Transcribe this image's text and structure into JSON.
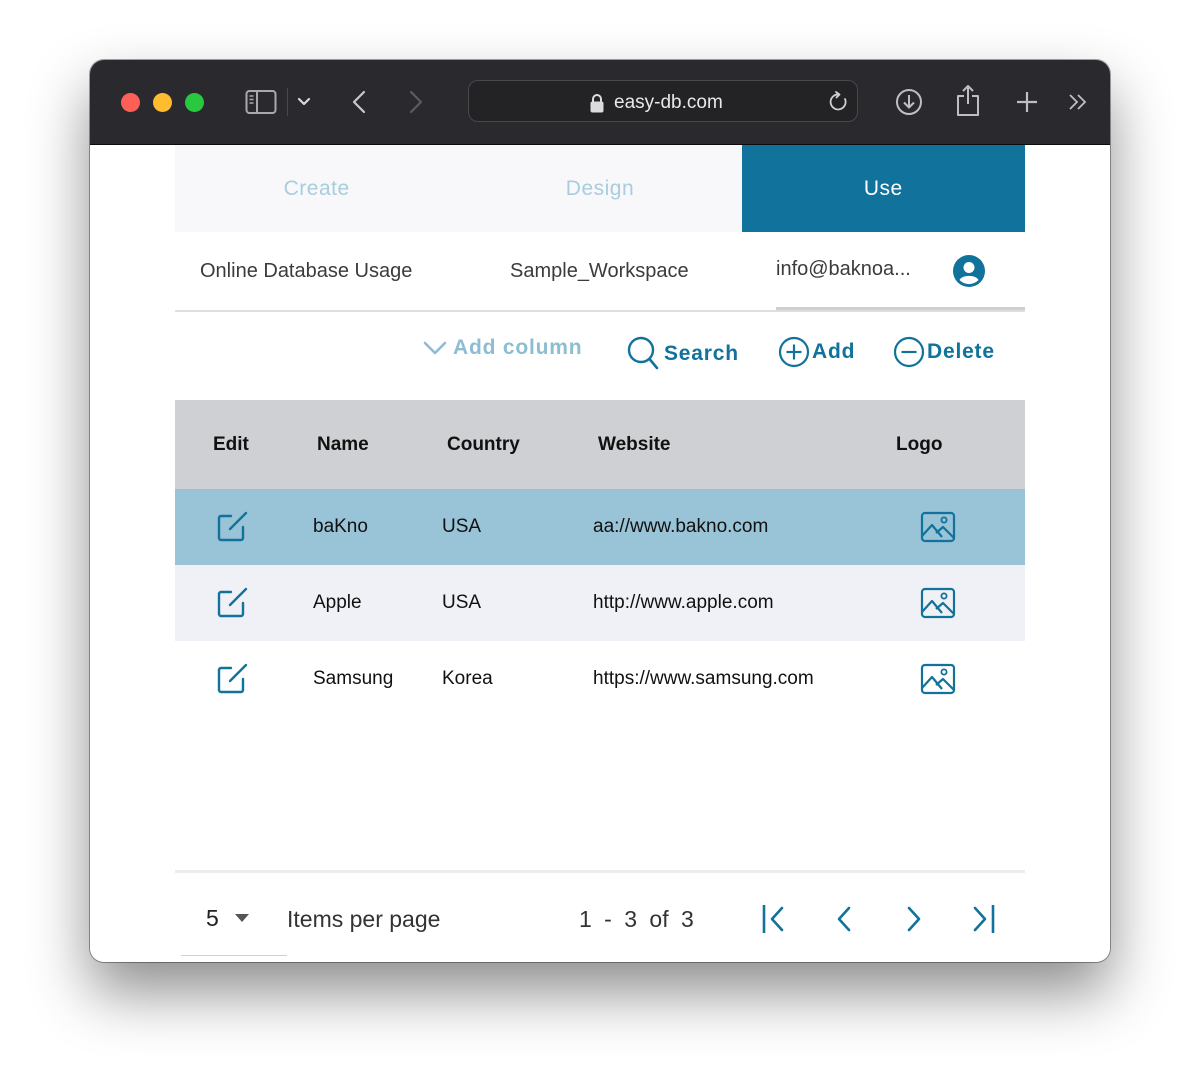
{
  "browser": {
    "url": "easy-db.com",
    "traffic_lights": {
      "close": "#fe5f57",
      "minimize": "#febc2e",
      "zoom": "#28c840"
    }
  },
  "tabs": [
    {
      "label": "Create",
      "active": false
    },
    {
      "label": "Design",
      "active": false
    },
    {
      "label": "Use",
      "active": true
    }
  ],
  "info": {
    "project": "Online Database Usage",
    "workspace": "Sample_Workspace",
    "user_email": "info@baknoa..."
  },
  "toolbar": {
    "add_column": "Add column",
    "search": "Search",
    "add": "Add",
    "delete": "Delete"
  },
  "table": {
    "columns": [
      "Edit",
      "Name",
      "Country",
      "Website",
      "Logo"
    ],
    "rows": [
      {
        "name": "baKno",
        "country": "USA",
        "website": "aa://www.bakno.com",
        "selected": true
      },
      {
        "name": "Apple",
        "country": "USA",
        "website": "http://www.apple.com",
        "selected": false
      },
      {
        "name": "Samsung",
        "country": "Korea",
        "website": "https://www.samsung.com",
        "selected": false
      }
    ]
  },
  "pagination": {
    "items_per_page_value": "5",
    "items_per_page_label": "Items per page",
    "range": "1 - 3 of 3"
  },
  "colors": {
    "accent": "#11729b",
    "selected_row": "#99c3d7",
    "alt_row": "#f0f1f6",
    "header_bg": "#cfd0d3"
  }
}
